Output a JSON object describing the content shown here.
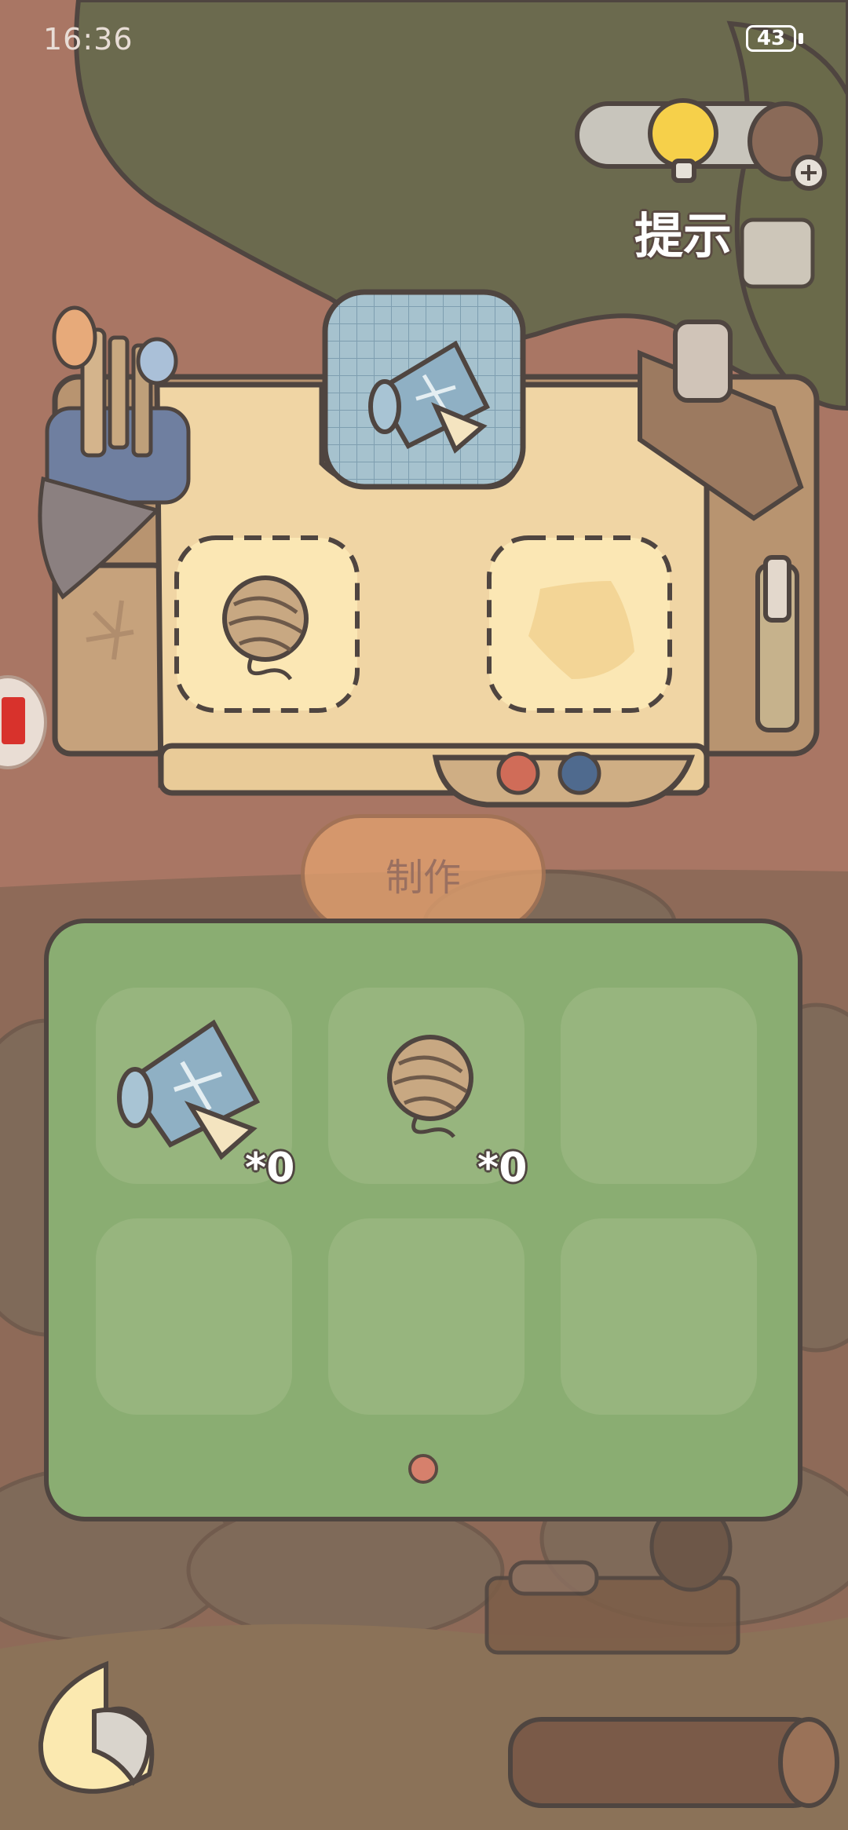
{
  "status_bar": {
    "time": "16:36",
    "battery": "43"
  },
  "hint": {
    "label": "提示"
  },
  "workbench": {
    "blueprint_icon": "blueprint-scroll-icon",
    "slot_left_icon": "yarn-ball-icon",
    "slot_right_icon": "cloth-patch-icon"
  },
  "make_button": {
    "label": "制作"
  },
  "inventory": {
    "items": [
      {
        "icon": "blueprint-scroll-icon",
        "count": "*0"
      },
      {
        "icon": "yarn-ball-icon",
        "count": "*0"
      },
      {
        "icon": "",
        "count": ""
      },
      {
        "icon": "",
        "count": ""
      },
      {
        "icon": "",
        "count": ""
      },
      {
        "icon": "",
        "count": ""
      }
    ],
    "page_indicator": "1"
  },
  "colors": {
    "panel_green": "#8aad72",
    "slot_green": "#97b57e",
    "board_tan": "#f0d5a4",
    "make_button": "#e2a06e",
    "outline": "#4f4540"
  }
}
